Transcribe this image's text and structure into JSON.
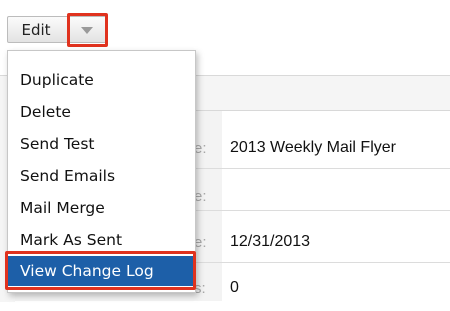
{
  "toolbar": {
    "edit_label": "Edit",
    "toggle_icon": "chevron-down-icon"
  },
  "dropdown": {
    "items": [
      "Duplicate",
      "Delete",
      "Send Test",
      "Send Emails",
      "Mail Merge",
      "Mark As Sent",
      "View Change Log"
    ],
    "selected": "View Change Log"
  },
  "record": {
    "rows": [
      {
        "label_fragment": "e:",
        "value": "2013 Weekly Mail Flyer"
      },
      {
        "label_fragment": "e:",
        "value": ""
      },
      {
        "label_fragment": "e:",
        "value": "12/31/2013"
      },
      {
        "label_fragment": "s:",
        "value": "0"
      }
    ]
  },
  "colors": {
    "highlight": "#e0321e",
    "menu_active_bg": "#1d5fa8"
  }
}
